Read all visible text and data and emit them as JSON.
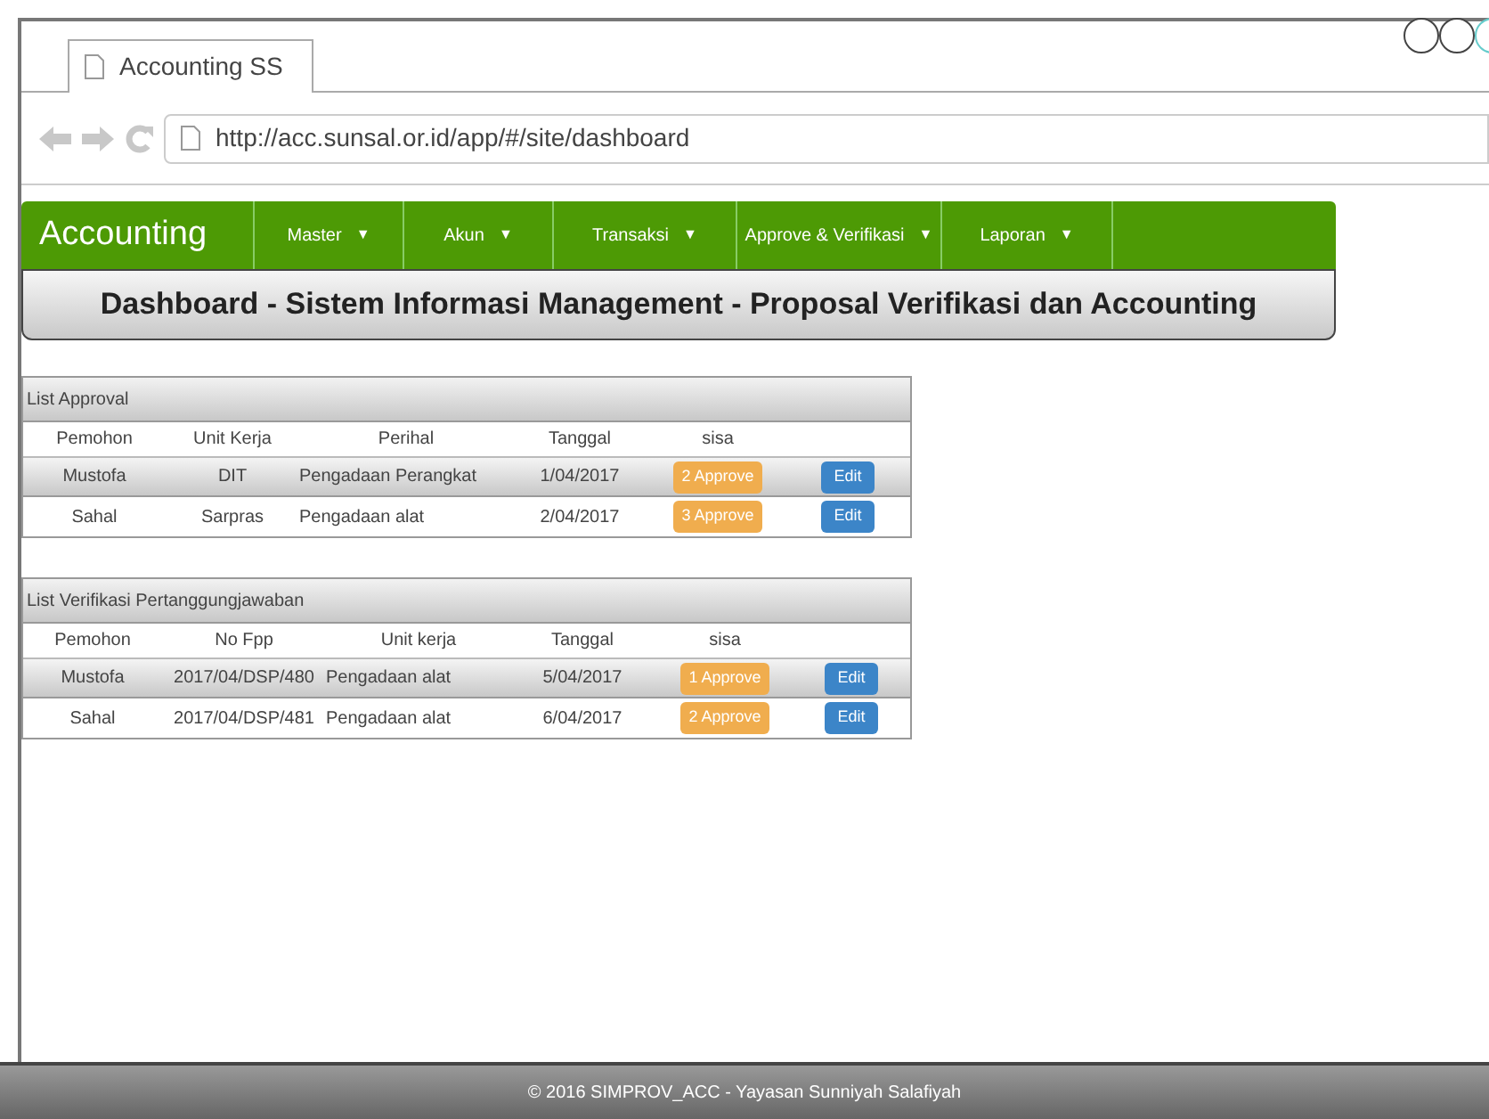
{
  "browser": {
    "tab_title": "Accounting SS",
    "url": "http://acc.sunsal.or.id/app/#/site/dashboard"
  },
  "navbar": {
    "brand": "Accounting",
    "menus": [
      {
        "label": "Master",
        "caret": "▼"
      },
      {
        "label": "Akun",
        "caret": "▼"
      },
      {
        "label": "Transaksi",
        "caret": "▼"
      },
      {
        "label": "Approve & Verifikasi",
        "caret": "▼"
      },
      {
        "label": "Laporan",
        "caret": "▼"
      }
    ]
  },
  "page_title": "Dashboard - Sistem Informasi Management - Proposal Verifikasi dan Accounting",
  "tables": [
    {
      "title": "List Approval",
      "columns": [
        "Pemohon",
        "Unit Kerja",
        "Perihal",
        "Tanggal",
        "sisa"
      ],
      "rows": [
        {
          "cells": [
            "Mustofa",
            "DIT",
            "Pengadaan Perangkat",
            "1/04/2017"
          ],
          "approve": "2 Approve",
          "action": "Edit"
        },
        {
          "cells": [
            "Sahal",
            "Sarpras",
            "Pengadaan alat",
            "2/04/2017"
          ],
          "approve": "3 Approve",
          "action": "Edit"
        }
      ]
    },
    {
      "title": "List Verifikasi Pertanggungjawaban",
      "columns": [
        "Pemohon",
        "No Fpp",
        "Unit kerja",
        "Tanggal",
        "sisa"
      ],
      "rows": [
        {
          "cells": [
            "Mustofa",
            "2017/04/DSP/480",
            "Pengadaan alat",
            "5/04/2017"
          ],
          "approve": "1 Approve",
          "action": "Edit"
        },
        {
          "cells": [
            "Sahal",
            "2017/04/DSP/481",
            "Pengadaan alat",
            "6/04/2017"
          ],
          "approve": "2 Approve",
          "action": "Edit"
        }
      ]
    }
  ],
  "footer": "© 2016 SIMPROV_ACC - Yayasan Sunniyah Salafiyah"
}
